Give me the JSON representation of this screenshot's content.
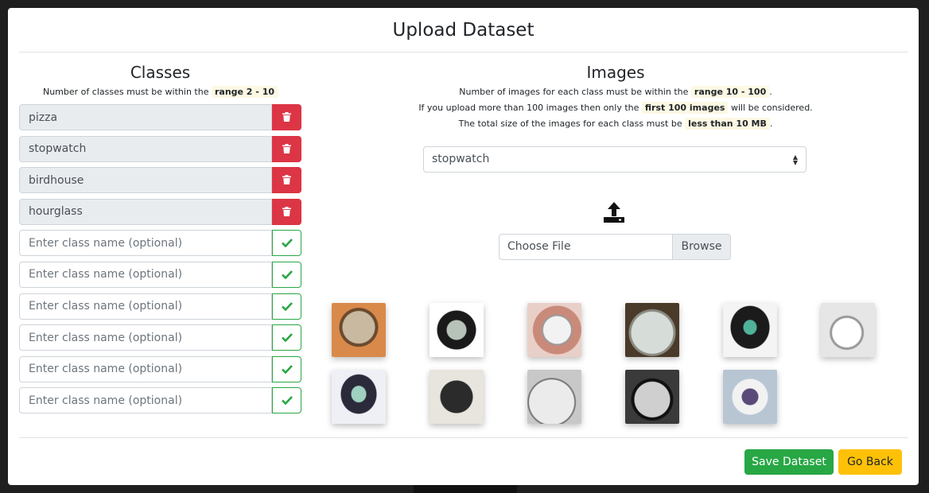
{
  "modal": {
    "title": "Upload Dataset"
  },
  "classes": {
    "title": "Classes",
    "note_prefix": "Number of classes must be within the",
    "note_range": "range 2 - 10",
    "filled": [
      "pizza",
      "stopwatch",
      "birdhouse",
      "hourglass"
    ],
    "empty_placeholder": "Enter class name (optional)",
    "empty_count": 6
  },
  "images": {
    "title": "Images",
    "line1_prefix": "Number of images for each class must be within the",
    "line1_range": "range 10 - 100",
    "line1_suffix": ".",
    "line2_prefix": "If you upload more than 100 images then only the",
    "line2_highlight": "first 100 images",
    "line2_suffix": "will be considered.",
    "line3_prefix": "The total size of the images for each class must be",
    "line3_highlight": "less than 10 MB",
    "line3_suffix": ".",
    "selected_class": "stopwatch",
    "file_placeholder": "Choose File",
    "browse_label": "Browse",
    "thumbnails": [
      "stopwatch-photo-1",
      "stopwatch-photo-2",
      "stopwatch-photo-3",
      "stopwatch-photo-4",
      "stopwatch-photo-5",
      "stopwatch-photo-6",
      "stopwatch-photo-7",
      "stopwatch-photo-8",
      "stopwatch-photo-9",
      "stopwatch-photo-10",
      "stopwatch-photo-11"
    ]
  },
  "footer": {
    "save_label": "Save Dataset",
    "back_label": "Go Back"
  },
  "colors": {
    "danger": "#dc3545",
    "success": "#28a745",
    "warning": "#ffc107",
    "highlight": "#fcf8e3"
  },
  "icons": {
    "delete": "trash-icon",
    "confirm": "check-icon",
    "upload": "upload-icon"
  }
}
